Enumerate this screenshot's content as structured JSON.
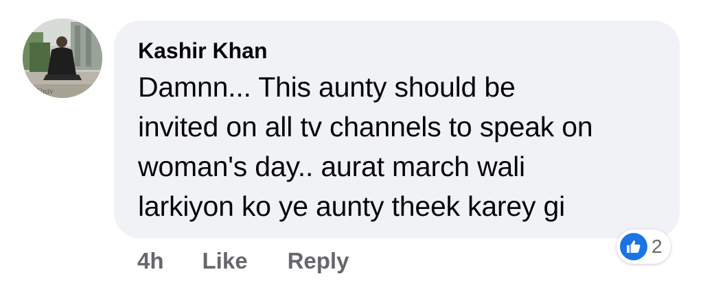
{
  "comment": {
    "author": "Kashir Khan",
    "text_lines": [
      "Damnn... This aunty should be",
      "invited on all tv channels to speak on",
      "woman's day.. aurat march wali",
      "larkiyon ko ye aunty theek karey gi"
    ],
    "avatar_icon": "profile-photo-graduate",
    "avatar_caption": "us Univ"
  },
  "actions": {
    "timestamp": "4h",
    "like_label": "Like",
    "reply_label": "Reply"
  },
  "reactions": {
    "icon": "like-thumb-icon",
    "count": "2",
    "color": "#1b74e4"
  },
  "colors": {
    "bubble": "#f0f2f5",
    "text": "#050505",
    "secondary": "#65676b"
  }
}
